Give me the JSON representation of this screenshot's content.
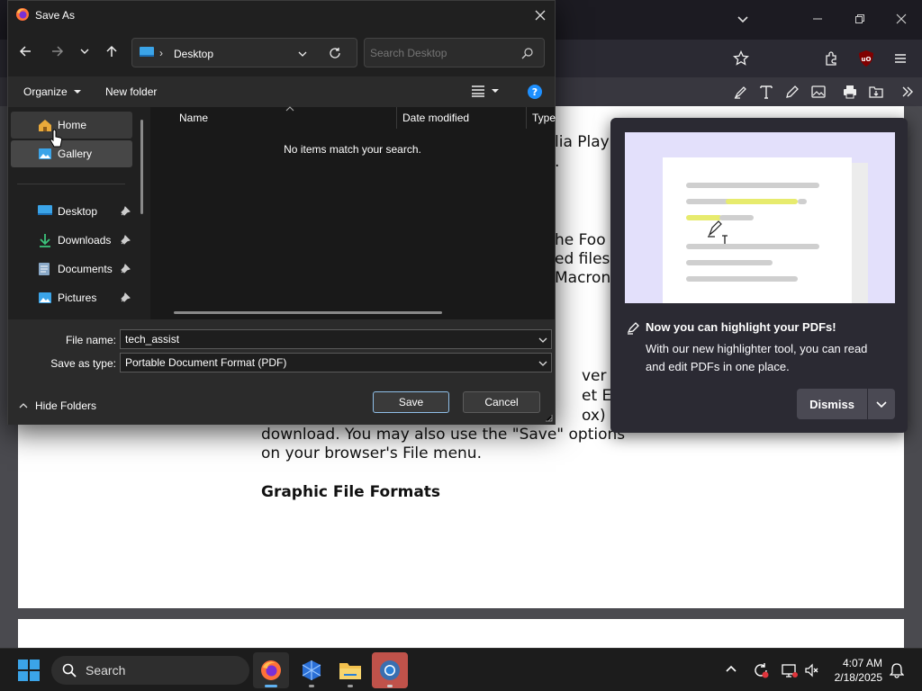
{
  "dialog": {
    "title": "Save As",
    "address_location": "Desktop",
    "search_placeholder": "Search Desktop",
    "organize_label": "Organize",
    "new_folder_label": "New folder",
    "nav_items": [
      {
        "label": "Home"
      },
      {
        "label": "Gallery"
      },
      {
        "label": "Desktop"
      },
      {
        "label": "Downloads"
      },
      {
        "label": "Documents"
      },
      {
        "label": "Pictures"
      }
    ],
    "columns": [
      "Name",
      "Date modified",
      "Type"
    ],
    "empty_message": "No items match your search.",
    "file_name_label": "File name:",
    "file_name_value": "tech_assist",
    "save_as_type_label": "Save as type:",
    "save_as_type_value": "Portable Document Format (PDF)",
    "hide_folders_label": "Hide Folders",
    "save_label": "Save",
    "cancel_label": "Cancel"
  },
  "popup": {
    "title": "Now you can highlight your PDFs!",
    "body": "With our new highlighter tool, you can read and edit PDFs in one place.",
    "dismiss_label": "Dismiss"
  },
  "pdf": {
    "right_fragments": [
      "lia Play",
      ".",
      "he Foo",
      "ed files",
      "Macron"
    ],
    "lines_lower": [
      "ver the",
      "et Expl",
      "ox) to",
      "download. You may also use the \"Save\" options",
      "on your browser's File menu."
    ],
    "heading": "Graphic File Formats"
  },
  "taskbar": {
    "search_placeholder": "Search",
    "time": "4:07 AM",
    "date": "2/18/2025"
  },
  "colors": {
    "accent_blue": "#0078d4",
    "highlight_yellow": "#e7eb6e",
    "help_blue": "#1e90ff"
  }
}
